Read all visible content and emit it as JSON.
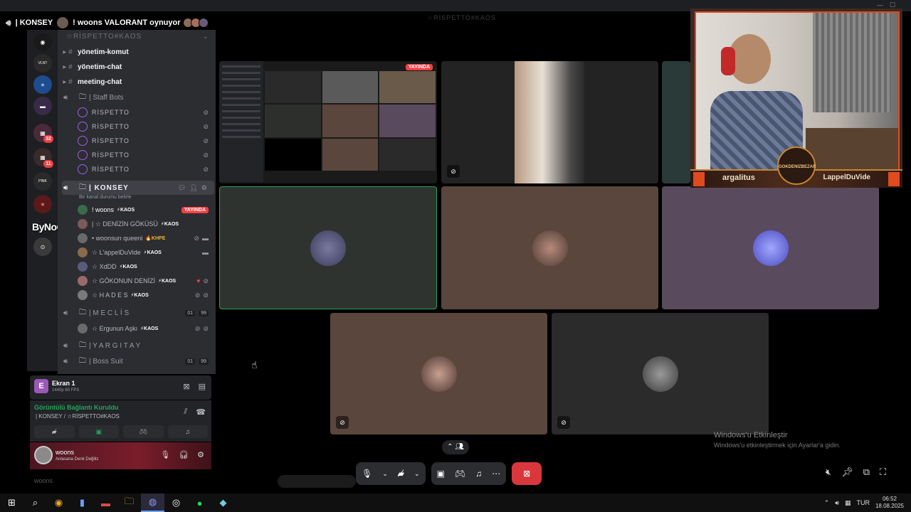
{
  "voice_header": {
    "channel": "| KONSEY",
    "activity": "! woons VALORANT oynuyor",
    "faded_server": "☆RİSPETTO#KAOS"
  },
  "sidebar": {
    "server_name": "☆RİSPETTO#KAOS",
    "text_channels": [
      "yönetim-komut",
      "yönetim-chat",
      "meeting-chat"
    ],
    "staff_category": "| Staff Bots",
    "staff_users": [
      "RİSPETTO",
      "RİSPETTO",
      "RİSPETTO",
      "RİSPETTO",
      "RİSPETTO"
    ],
    "active_voice": {
      "name": "| KONSEY",
      "status": "Bir kanal durumu belirle"
    },
    "voice_users": [
      {
        "name": "! woons",
        "tag": "⚡KAOS",
        "live": "YAYINDA"
      },
      {
        "name": "| ☆ DENİZİN GÖKÜSÜ",
        "tag": "⚡KAOS"
      },
      {
        "name": "• woonsun queeni",
        "tag": "🔥KHPE"
      },
      {
        "name": "☆ L'appelDuVide",
        "tag": "⚡KAOS"
      },
      {
        "name": "☆ XdDD",
        "tag": "⚡KAOS"
      },
      {
        "name": "☆ GÖKONUN DENİZİ",
        "tag": "⚡KAOS"
      },
      {
        "name": "☆ H A D E S",
        "tag": "⚡KAOS"
      }
    ],
    "meclis": {
      "name": "| M E C L İ S",
      "pill1": "01",
      "pill2": "99"
    },
    "meclis_user": {
      "name": "☆ Ergunun Aşkı",
      "tag": "⚡KAOS"
    },
    "yargitay": "| Y A R G I T A Y",
    "boss_suit": {
      "name": "| Boss Suit",
      "pill1": "01",
      "pill2": "99"
    }
  },
  "server_rail": {
    "badge1": "32",
    "badge2": "11"
  },
  "overlay_brand": "ByNoGame",
  "screen_panel": {
    "letter": "E",
    "title": "Ekran 1",
    "subtitle": "1440p 60 FPS"
  },
  "connection": {
    "status": "Görüntülü Bağlantı Kuruldu",
    "channel": "| KONSEY / ☆RİSPETTO#KAOS"
  },
  "user_panel": {
    "username": "woons",
    "status": "Anlasana Denk Değiliz",
    "faded_username": "woons"
  },
  "stream_preview": {
    "live_label": "YAYINDA"
  },
  "webcam": {
    "left_name": "argalitus",
    "right_name": "LappelDuVide",
    "logo": "GOKDENIZBEZAR"
  },
  "windows_activation": {
    "title": "Windows'u Etkinleştir",
    "subtitle": "Windows'u etkinleştirmek için Ayarlar'a gidin."
  },
  "taskbar": {
    "language": "TUR",
    "time": "06:52",
    "date": "18.08.2025"
  },
  "colors": {
    "live_red": "#f23f43",
    "connected_green": "#23a55a",
    "end_call_red": "#da373c",
    "webcam_border": "#e04a1f"
  }
}
